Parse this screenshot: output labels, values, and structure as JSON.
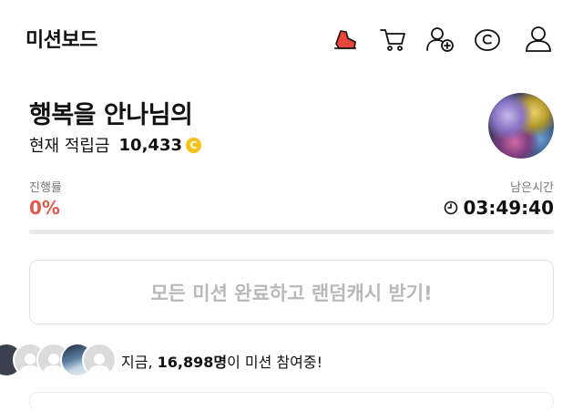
{
  "header": {
    "title": "미션보드",
    "icons": [
      "mission-shoe-icon",
      "cart-icon",
      "add-friend-icon",
      "cash-coin-icon",
      "profile-icon"
    ],
    "accent_color": "#e05a4f"
  },
  "user": {
    "name": "행복을 안나님의",
    "balance_label": "현재 적립금",
    "balance_value": "10,433",
    "balance_coin_icon": "coin-icon"
  },
  "progress": {
    "label": "진행률",
    "value_text": "0%",
    "fraction": 0.0
  },
  "timer": {
    "label": "남은시간",
    "value": "03:49:40",
    "icon": "clock-icon"
  },
  "claim_button": {
    "label": "모든 미션 완료하고 랜덤캐시 받기!"
  },
  "participants": {
    "prefix": "지금, ",
    "count": "16,898명",
    "suffix": "이 미션 참여중!"
  }
}
